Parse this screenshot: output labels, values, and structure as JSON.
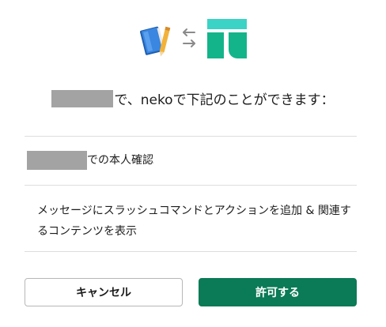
{
  "dialog": {
    "headline_text": "で、nekoで下記のことができます：",
    "permissions": [
      {
        "text": "での本人確認"
      },
      {
        "text": "メッセージにスラッシュコマンドとアクションを追加 & 関連するコンテンツを表示"
      }
    ]
  },
  "buttons": {
    "cancel_label": "キャンセル",
    "allow_label": "許可する"
  },
  "icons": {
    "app_icon": "blue-book-with-pencil-icon",
    "connection_icon": "swap-arrows-icon",
    "workspace_icon": "green-t-logo-icon"
  },
  "colors": {
    "accent": "#0b7a56",
    "workspace_green": "#13b48a",
    "workspace_teal": "#3ad3c5",
    "redaction": "#a3a3a3"
  }
}
